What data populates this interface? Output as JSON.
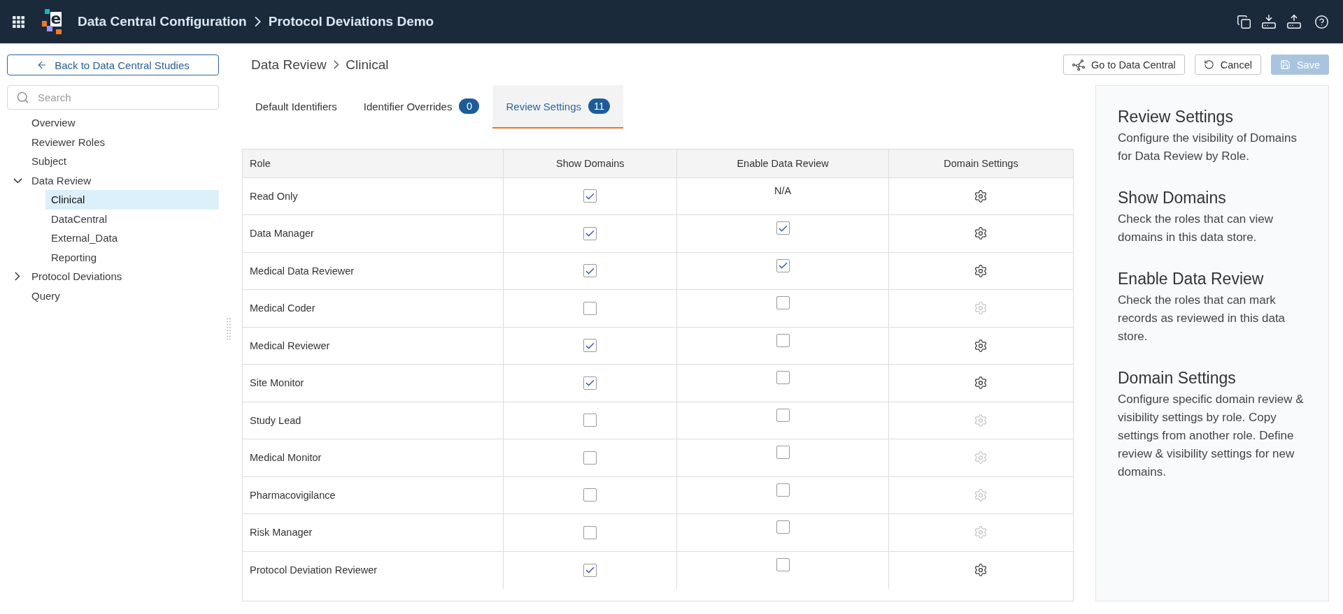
{
  "app_bar": {
    "logo_text": "e",
    "breadcrumb": [
      "Data Central Configuration",
      "Protocol Deviations Demo"
    ]
  },
  "sidebar": {
    "back_button": "Back to Data Central Studies",
    "search": {
      "placeholder": "Search"
    },
    "items": [
      {
        "label": "Overview",
        "selected": false
      },
      {
        "label": "Reviewer Roles",
        "selected": false
      },
      {
        "label": "Subject",
        "selected": false
      },
      {
        "label": "Data Review",
        "expanded": true,
        "selected": false,
        "children": [
          {
            "label": "Clinical",
            "selected": true
          },
          {
            "label": "DataCentral",
            "selected": false
          },
          {
            "label": "External_Data",
            "selected": false
          },
          {
            "label": "Reporting",
            "selected": false
          }
        ]
      },
      {
        "label": "Protocol Deviations",
        "expanded": false,
        "selected": false
      },
      {
        "label": "Query",
        "selected": false
      }
    ]
  },
  "page": {
    "breadcrumb": [
      "Data Review",
      "Clinical"
    ],
    "buttons": [
      {
        "kind": "link",
        "label": "Go to Data Central",
        "disabled": false
      },
      {
        "kind": "cancel",
        "label": "Cancel",
        "disabled": false
      },
      {
        "kind": "save",
        "label": "Save",
        "disabled": true
      }
    ]
  },
  "tabs": [
    {
      "label": "Default Identifiers",
      "selected": false
    },
    {
      "label": "Identifier Overrides",
      "badge": "0",
      "selected": false
    },
    {
      "label": "Review Settings",
      "badge": "11",
      "selected": true
    }
  ],
  "table": {
    "columns": [
      "Role",
      "Show Domains",
      "Enable Data Review",
      "Domain Settings"
    ],
    "rows": [
      {
        "role": "Read Only",
        "show_domains": {
          "checked": true
        },
        "enable_data_review": {
          "kind": "text",
          "text": "N/A"
        },
        "domain_settings": {
          "disabled": false
        }
      },
      {
        "role": "Data Manager",
        "show_domains": {
          "checked": true
        },
        "enable_data_review": {
          "kind": "checkbox",
          "checked": true
        },
        "domain_settings": {
          "disabled": false
        }
      },
      {
        "role": "Medical Data Reviewer",
        "show_domains": {
          "checked": true
        },
        "enable_data_review": {
          "kind": "checkbox",
          "checked": true
        },
        "domain_settings": {
          "disabled": false
        }
      },
      {
        "role": "Medical Coder",
        "show_domains": {
          "checked": false
        },
        "enable_data_review": {
          "kind": "checkbox",
          "checked": false
        },
        "domain_settings": {
          "disabled": true
        }
      },
      {
        "role": "Medical Reviewer",
        "show_domains": {
          "checked": true
        },
        "enable_data_review": {
          "kind": "checkbox",
          "checked": false
        },
        "domain_settings": {
          "disabled": false
        }
      },
      {
        "role": "Site Monitor",
        "show_domains": {
          "checked": true
        },
        "enable_data_review": {
          "kind": "checkbox",
          "checked": false
        },
        "domain_settings": {
          "disabled": false
        }
      },
      {
        "role": "Study Lead",
        "show_domains": {
          "checked": false
        },
        "enable_data_review": {
          "kind": "checkbox",
          "checked": false
        },
        "domain_settings": {
          "disabled": true
        }
      },
      {
        "role": "Medical Monitor",
        "show_domains": {
          "checked": false
        },
        "enable_data_review": {
          "kind": "checkbox",
          "checked": false
        },
        "domain_settings": {
          "disabled": true
        }
      },
      {
        "role": "Pharmacovigilance",
        "show_domains": {
          "checked": false
        },
        "enable_data_review": {
          "kind": "checkbox",
          "checked": false
        },
        "domain_settings": {
          "disabled": true
        }
      },
      {
        "role": "Risk Manager",
        "show_domains": {
          "checked": false
        },
        "enable_data_review": {
          "kind": "checkbox",
          "checked": false
        },
        "domain_settings": {
          "disabled": true
        }
      },
      {
        "role": "Protocol Deviation Reviewer",
        "show_domains": {
          "checked": true
        },
        "enable_data_review": {
          "kind": "checkbox",
          "checked": false
        },
        "domain_settings": {
          "disabled": false
        }
      }
    ]
  },
  "help_panel": {
    "sections": [
      {
        "title": "Review Settings",
        "text": "Configure the visibility of Domains for Data Review by Role."
      },
      {
        "title": "Show Domains",
        "text": "Check the roles that can view domains in this data store."
      },
      {
        "title": "Enable Data Review",
        "text": "Check the roles that can mark records as reviewed in this data store."
      },
      {
        "title": "Domain Settings",
        "text": "Configure specific domain review & visibility settings by role. Copy settings from another role. Define review & visibility settings for new domains."
      }
    ]
  }
}
